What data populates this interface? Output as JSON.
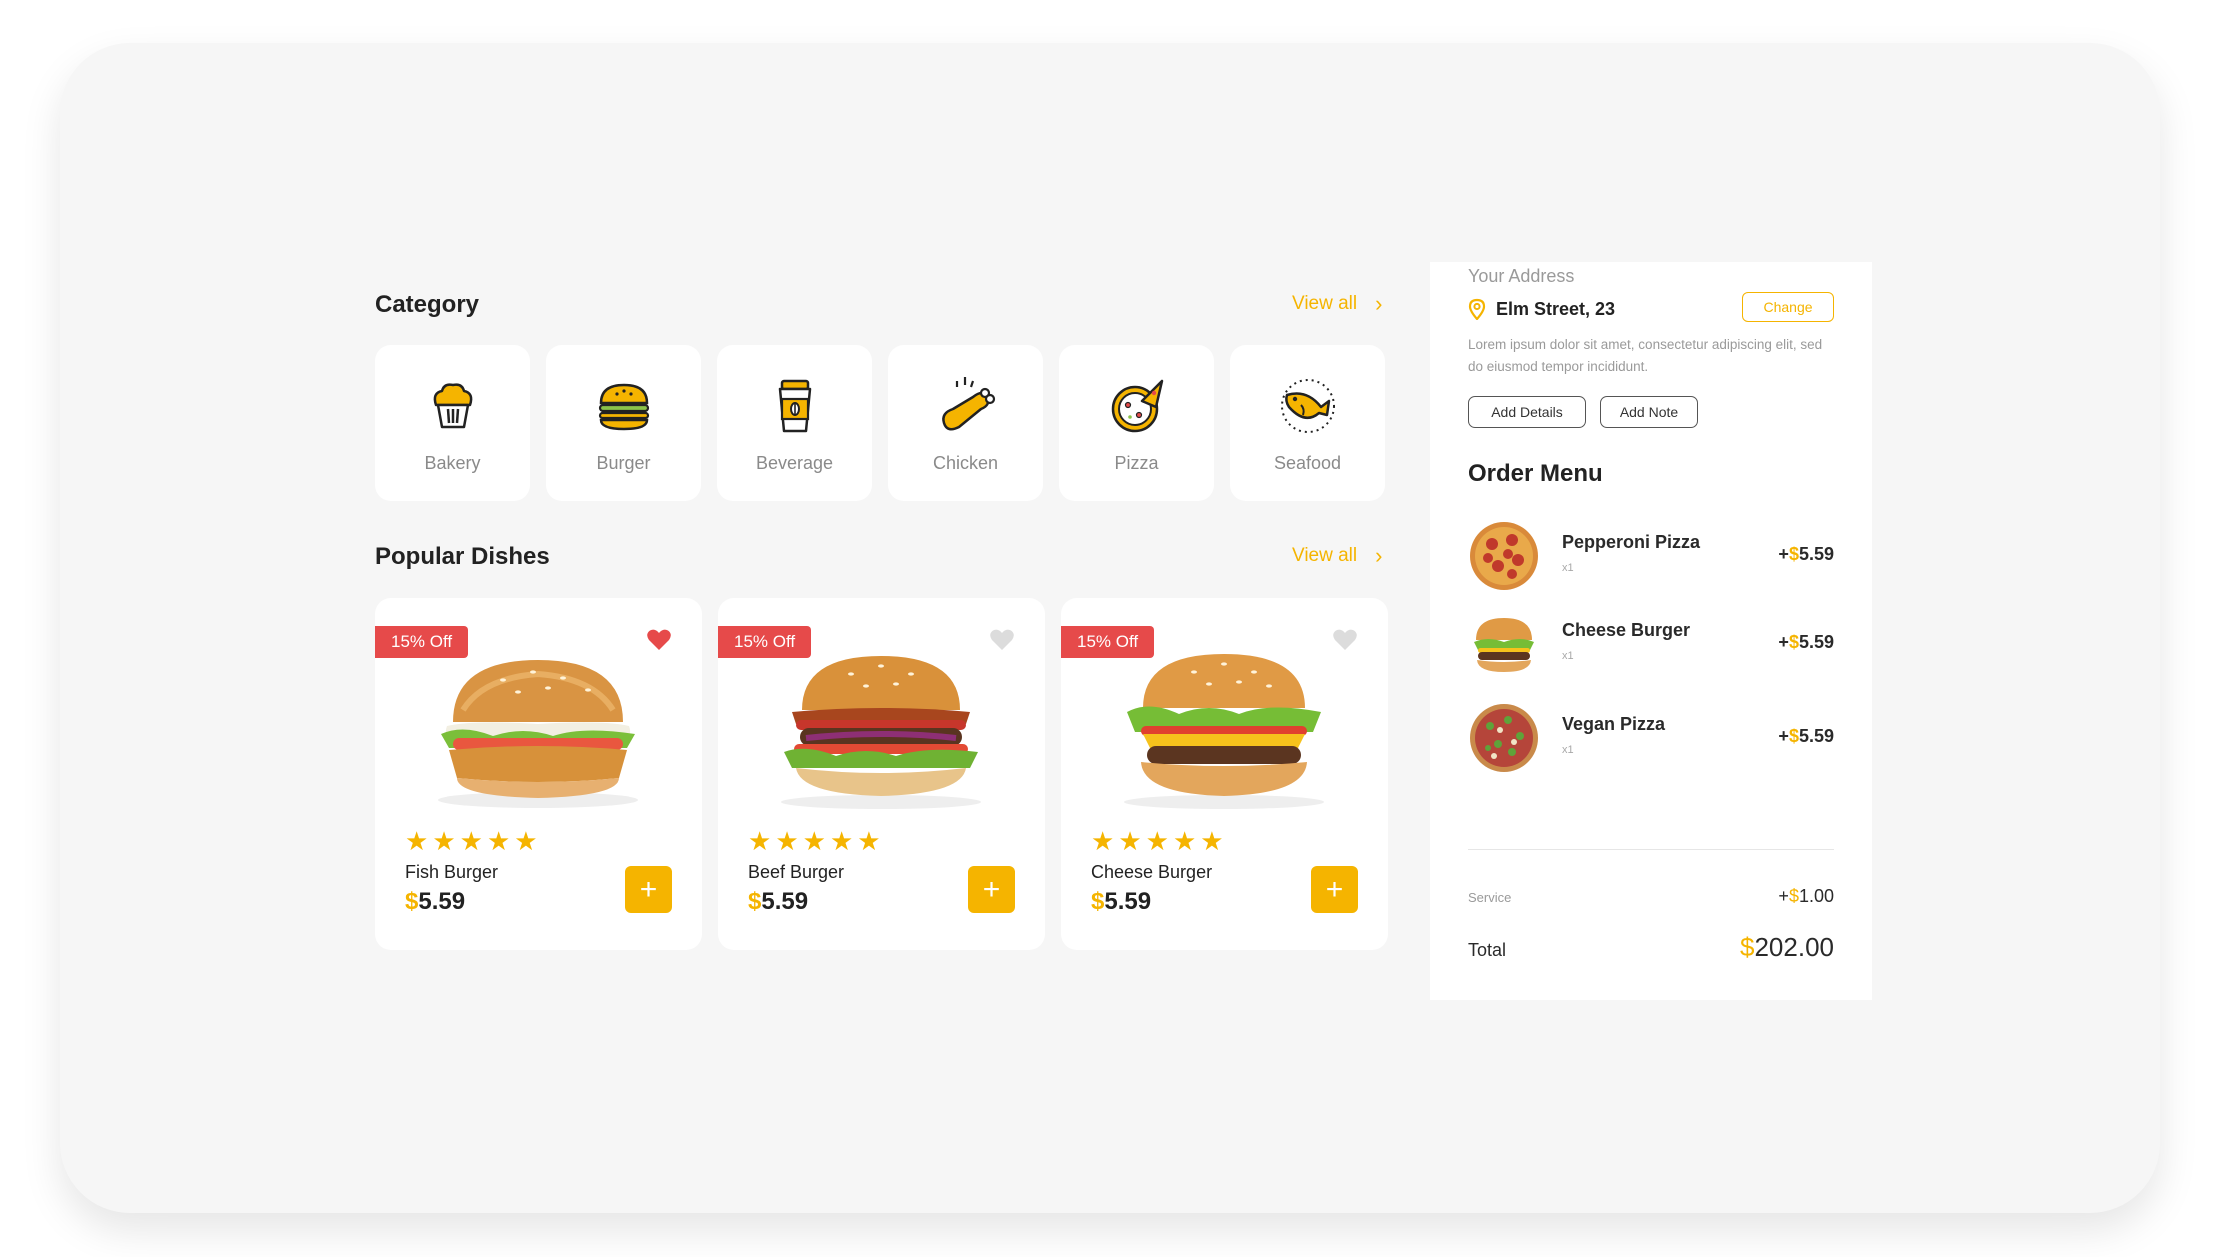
{
  "category": {
    "title": "Category",
    "view_all": "View all",
    "items": [
      {
        "label": "Bakery",
        "icon": "muffin-icon"
      },
      {
        "label": "Burger",
        "icon": "burger-icon"
      },
      {
        "label": "Beverage",
        "icon": "coffee-cup-icon"
      },
      {
        "label": "Chicken",
        "icon": "chicken-leg-icon"
      },
      {
        "label": "Pizza",
        "icon": "pizza-icon"
      },
      {
        "label": "Seafood",
        "icon": "fish-icon"
      }
    ]
  },
  "popular": {
    "title": "Popular Dishes",
    "view_all": "View all",
    "dishes": [
      {
        "badge": "15% Off",
        "name": "Fish Burger",
        "currency": "$",
        "price": "5.59",
        "favorited": true,
        "rating": 5
      },
      {
        "badge": "15% Off",
        "name": "Beef Burger",
        "currency": "$",
        "price": "5.59",
        "favorited": false,
        "rating": 5
      },
      {
        "badge": "15% Off",
        "name": "Cheese Burger",
        "currency": "$",
        "price": "5.59",
        "favorited": false,
        "rating": 5
      }
    ],
    "add_label": "+"
  },
  "address": {
    "label": "Your Address",
    "street": "Elm Street, 23",
    "change_label": "Change",
    "description": "Lorem ipsum dolor sit amet, consectetur adipiscing elit, sed do eiusmod tempor incididunt.",
    "add_details": "Add Details",
    "add_note": "Add Note"
  },
  "order": {
    "title": "Order Menu",
    "items": [
      {
        "name": "Pepperoni Pizza",
        "qty": "x1",
        "prefix": "+",
        "currency": "$",
        "price": "5.59"
      },
      {
        "name": "Cheese Burger",
        "qty": "x1",
        "prefix": "+",
        "currency": "$",
        "price": "5.59"
      },
      {
        "name": "Vegan Pizza",
        "qty": "x1",
        "prefix": "+",
        "currency": "$",
        "price": "5.59"
      }
    ],
    "service_label": "Service",
    "service_prefix": "+",
    "service_currency": "$",
    "service_value": "1.00",
    "total_label": "Total",
    "total_currency": "$",
    "total_value": "202.00"
  },
  "colors": {
    "accent": "#f5b400",
    "badge": "#e64a4a",
    "heart_active": "#e64a4a",
    "heart_inactive": "#dcdcdc"
  }
}
